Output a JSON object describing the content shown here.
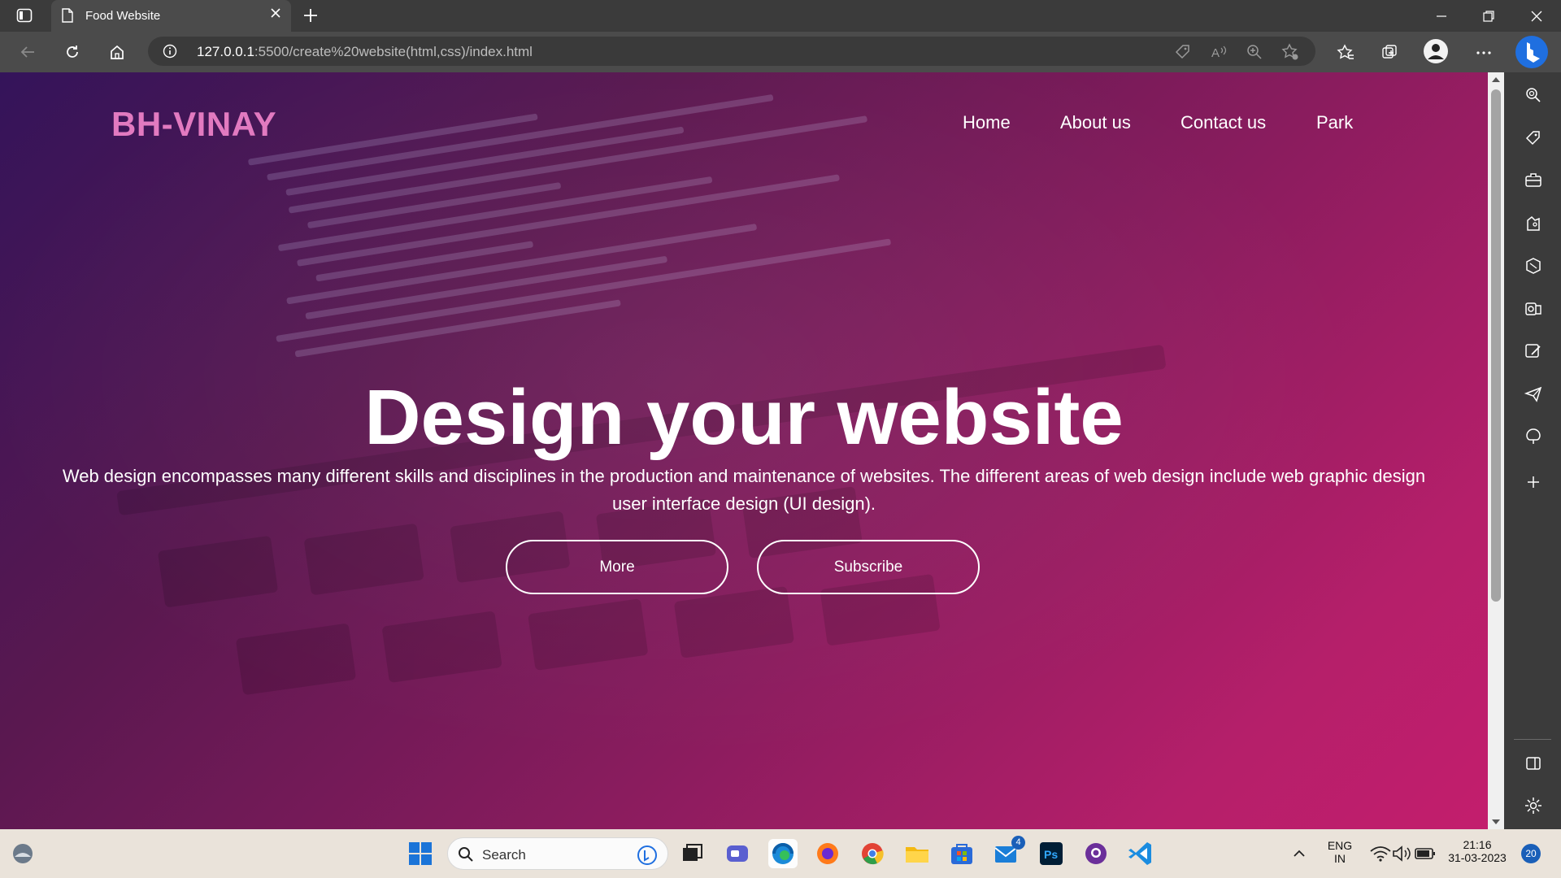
{
  "browser": {
    "tab_title": "Food Website",
    "url_host": "127.0.0.1",
    "url_rest": ":5500/create%20website(html,css)/index.html"
  },
  "site": {
    "logo": "BH-VINAY",
    "nav": [
      "Home",
      "About us",
      "Contact us",
      "Park"
    ],
    "hero_title": "Design your website",
    "hero_subtitle": "Web design encompasses many different skills and disciplines in the production and maintenance of websites. The different areas of web design include web graphic design user interface design (UI design).",
    "buttons": [
      "More",
      "Subscribe"
    ]
  },
  "taskbar": {
    "search_label": "Search",
    "lang_top": "ENG",
    "lang_bottom": "IN",
    "time": "21:16",
    "date": "31-03-2023",
    "notification_count": "20",
    "mail_badge": "4"
  },
  "colors": {
    "logo": "#e27ac0",
    "gradient_start": "#34145a",
    "gradient_end": "#c31e6d"
  },
  "icons": [
    "tab-actions-icon",
    "page-icon",
    "close-icon",
    "plus-icon",
    "back-icon",
    "refresh-icon",
    "home-icon",
    "info-icon",
    "tag-icon",
    "read-aloud-icon",
    "zoom-icon",
    "favorite-add-icon",
    "favorites-icon",
    "collections-icon",
    "profile-icon",
    "more-icon",
    "bing-icon",
    "search-icon",
    "shopping-icon",
    "tools-icon",
    "games-icon",
    "office-icon",
    "outlook-icon",
    "drop-icon",
    "telegram-icon",
    "m365-icon",
    "sidebar-toggle-icon",
    "settings-icon"
  ]
}
